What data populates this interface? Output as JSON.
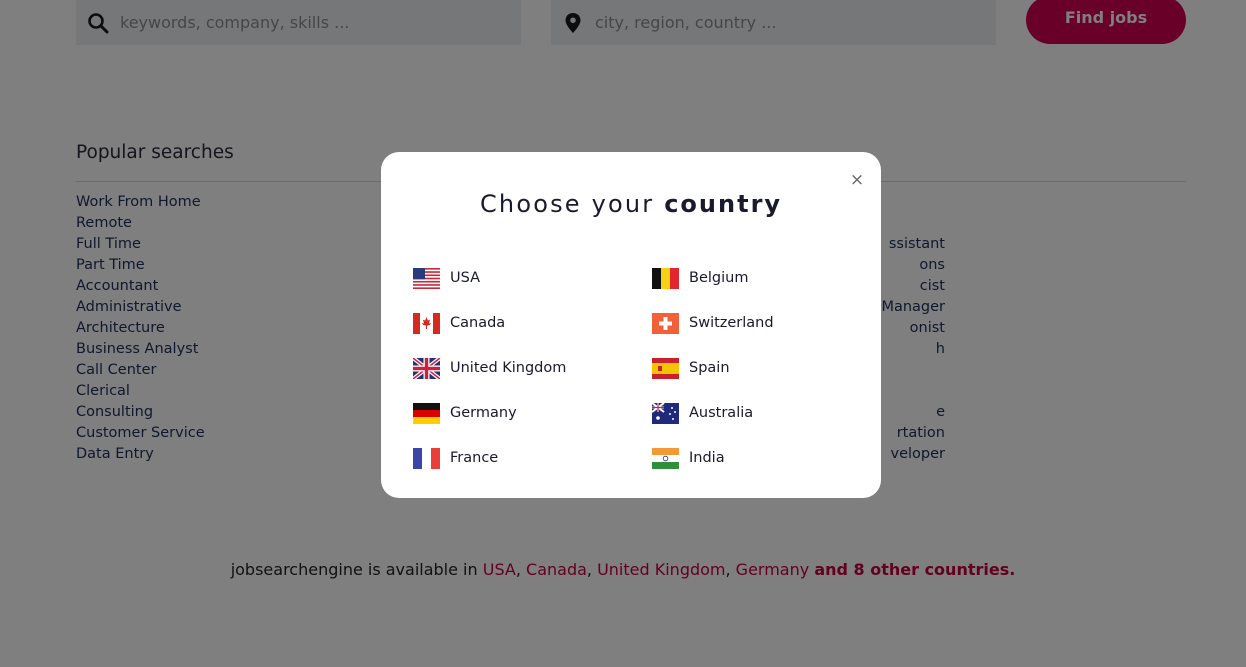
{
  "search": {
    "keywords_placeholder": "keywords, company, skills ...",
    "location_placeholder": "city, region, country ...",
    "find_button": "Find jobs"
  },
  "popular": {
    "title": "Popular searches",
    "left_items": [
      "Work From Home",
      "Remote",
      "Full Time",
      "Part Time",
      "Accountant",
      "Administrative",
      "Architecture",
      "Business Analyst",
      "Call Center",
      "Clerical",
      "Consulting",
      "Customer Service",
      "Data Entry"
    ],
    "right_items": [
      "ssistant",
      "ons",
      "cist",
      "Manager",
      "onist",
      "h",
      "",
      "",
      "e",
      "rtation",
      "veloper"
    ]
  },
  "footer": {
    "prefix": "jobsearchengine is available in",
    "countries": [
      "USA",
      "Canada",
      "United Kingdom",
      "Germany"
    ],
    "more": "and 8 other countries."
  },
  "modal": {
    "close": "×",
    "title_regular": "Choose your",
    "title_bold": "country",
    "countries": [
      {
        "name": "USA",
        "flag": "us-flag-icon"
      },
      {
        "name": "Canada",
        "flag": "ca-flag-icon"
      },
      {
        "name": "United Kingdom",
        "flag": "gb-flag-icon"
      },
      {
        "name": "Germany",
        "flag": "de-flag-icon"
      },
      {
        "name": "France",
        "flag": "fr-flag-icon"
      },
      {
        "name": "Belgium",
        "flag": "be-flag-icon"
      },
      {
        "name": "Switzerland",
        "flag": "ch-flag-icon"
      },
      {
        "name": "Spain",
        "flag": "es-flag-icon"
      },
      {
        "name": "Australia",
        "flag": "au-flag-icon"
      },
      {
        "name": "India",
        "flag": "in-flag-icon"
      }
    ]
  },
  "colors": {
    "accent": "#d1004f",
    "link": "#20305a",
    "overlay": "rgba(0,0,0,0.5)"
  }
}
